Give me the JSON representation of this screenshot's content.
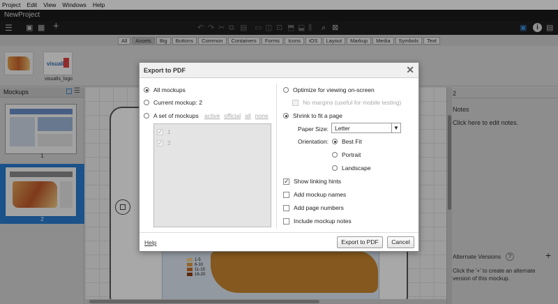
{
  "menu": [
    "Project",
    "Edit",
    "View",
    "Windows",
    "Help"
  ],
  "app": {
    "title": "NewProject"
  },
  "filters": {
    "items": [
      "All",
      "Assets",
      "Big",
      "Buttons",
      "Common",
      "Containers",
      "Forms",
      "Icons",
      "iOS",
      "Layout",
      "Markup",
      "Media",
      "Symbols",
      "Text"
    ],
    "selected": "Assets"
  },
  "assets": {
    "logo_label": "visualis_logo",
    "logo_text": "visualis"
  },
  "left_panel": {
    "title": "Mockups",
    "thumbs": [
      "1",
      "2"
    ],
    "selected": "2"
  },
  "right_panel": {
    "page_label": "2",
    "notes_title": "Notes",
    "notes_hint": "Click here to edit notes.",
    "alt_title": "Alternate Versions",
    "alt_help": "?",
    "alt_add": "+",
    "alt_desc": "Click the '+' to create an alternate version of this mockup."
  },
  "legend": [
    "1-5",
    "6-10",
    "11-15",
    "16-20"
  ],
  "dialog": {
    "title": "Export to PDF",
    "close": "✕",
    "all_mockups": "All mockups",
    "current_mockup": "Current mockup: 2",
    "set_of_mockups": "A set of mockups",
    "set_links": [
      "active",
      "official",
      "all",
      "none"
    ],
    "list_items": [
      "1",
      "2"
    ],
    "optimize": "Optimize for viewing on-screen",
    "no_margins": "No margins (useful for mobile testing)",
    "shrink": "Shrink to fit a page",
    "paper_size_label": "Paper Size:",
    "paper_size_value": "Letter",
    "orientation_label": "Orientation:",
    "orientations": [
      "Best Fit",
      "Portrait",
      "Landscape"
    ],
    "show_linking": "Show linking hints",
    "add_names": "Add mockup names",
    "add_numbers": "Add page numbers",
    "include_notes": "Include mockup notes",
    "help": "Help",
    "export_button": "Export to PDF",
    "cancel_button": "Cancel"
  }
}
